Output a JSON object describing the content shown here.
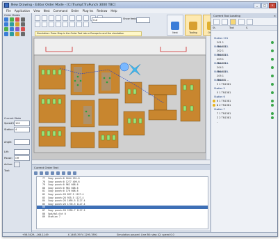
{
  "window": {
    "title": "New Drawing - Editor Order Mode - [C:\\Trumpf.TruPunch 3000 TBC]",
    "buttons": [
      "_",
      "□",
      "×"
    ]
  },
  "menu": [
    "File",
    "Application",
    "View",
    "Nest",
    "Command",
    "Order",
    "Plug-ins",
    "Redraw",
    "Help"
  ],
  "left_panel": {
    "order_modes_label": "Order Modes",
    "current_state_label": "Current State",
    "fields": [
      {
        "label": "Speed%:",
        "value": "100"
      },
      {
        "label": "Station:",
        "value": "4"
      },
      {
        "label": "Angle:",
        "value": ""
      },
      {
        "label": "Lift:",
        "value": ""
      },
      {
        "label": "Pause:",
        "value": "Off"
      },
      {
        "label": "Active:",
        "value": ""
      },
      {
        "label": "Tool:",
        "value": ""
      }
    ]
  },
  "toolbar": {
    "sim_dropdown": "Cut",
    "sim_label": "Show features",
    "hint": "Simulation: Press Stop in the Order Tool tab or Escape to end the simulation",
    "big_buttons": [
      "Nest",
      "Tooling",
      "Order",
      "Tooling",
      "Options"
    ]
  },
  "right_panel": {
    "title": "Current Tool Loading",
    "columns": [
      "St.",
      "Tool",
      "S."
    ],
    "stations": [
      {
        "name": "Station 201",
        "tool": "201  1  TN1381 ..",
        "flag": "ok"
      },
      {
        "name": "Station 202",
        "tool": "202  1  TN1381 ..",
        "flag": "ok"
      },
      {
        "name": "Station 203",
        "tool": "203  1  TN1381 ..",
        "flag": "ok"
      },
      {
        "name": "Station 204",
        "tool": "204  1  TN1381 ..",
        "flag": "ok"
      },
      {
        "name": "Station 205",
        "tool": "205  1  TN1381 ..",
        "flag": "ok"
      },
      {
        "name": "Station 3",
        "tool": "3  1  TN1381 ..",
        "flag": "ok"
      },
      {
        "name": "Station 5",
        "tool": "5  1  TN1381 ..",
        "flag": "ok"
      },
      {
        "name": "Station 6",
        "tool": "6  1  TN1381 ..",
        "flag": "warn"
      },
      {
        "name": "",
        "tool": "6  2  TN1381 ..",
        "flag": "warn"
      },
      {
        "name": "Station 7",
        "tool": "7  1  TN1381 ..",
        "flag": "ok"
      },
      {
        "name": "",
        "tool": "7  2  TN1381 ..",
        "flag": "ok"
      }
    ]
  },
  "order_text": {
    "title": "Current Order Text",
    "lines": [
      "77  Copy punch:0 1644 291.6",
      "78  Copy punch:0 1277 409.6",
      "79  Copy punch:0 962 608.6",
      "80  Copy punch:0 962 608.6",
      "81  Copy punch:0 176 608.6",
      "82  Copy punch:28 857.5 1127.4",
      "83  Copy punch:28 935.5 1127.4",
      "84  Copy punch:28 1095.5 1127.4",
      "85  Copy punch:28 1735.5 1127.4",
      "86  ",
      "87  Copy punch:28 2395.7 1127.5",
      "88  Spd/dwl=Cnt 0",
      "89  Station 7"
    ],
    "selected_index": 9
  },
  "status": [
    "+56.5029, -164.1149",
    "X 1465.3974 1295.7891",
    "Simulation paused: Line 86: step 42; speed 0.0"
  ]
}
